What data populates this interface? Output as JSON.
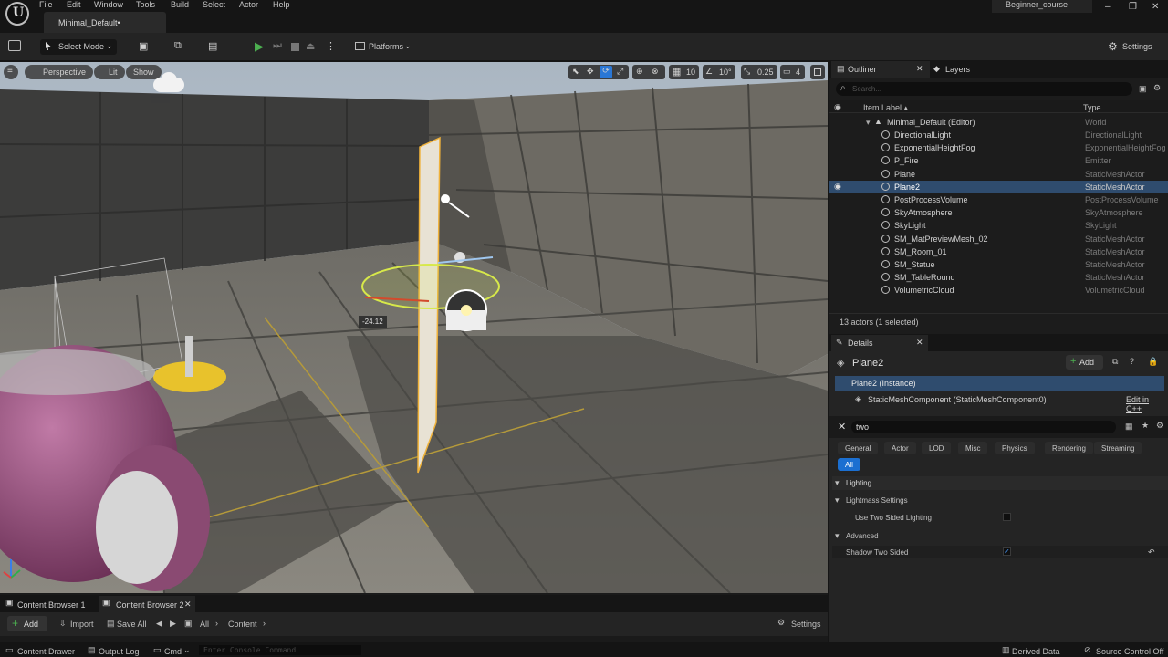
{
  "menubar": {
    "items": [
      "File",
      "Edit",
      "Window",
      "Tools",
      "Build",
      "Select",
      "Actor",
      "Help"
    ],
    "level_tab": "Minimal_Default•",
    "project": "Beginner_course",
    "window_controls": [
      "–",
      "❐",
      "✕"
    ]
  },
  "toolbar": {
    "select_mode": "Select Mode",
    "platforms": "Platforms",
    "settings": "Settings"
  },
  "viewport": {
    "perspective": "Perspective",
    "lit": "Lit",
    "show": "Show",
    "grid_snap": "10",
    "rot_snap": "10°",
    "scale_snap": "0.25",
    "cam_speed": "4",
    "gizmo_value": "-24.12"
  },
  "outliner": {
    "tab": "Outliner",
    "layers_tab": "Layers",
    "search_placeholder": "Search...",
    "col_label": "Item Label ▴",
    "col_type": "Type",
    "world_row": {
      "label": "Minimal_Default (Editor)",
      "type": "World"
    },
    "rows": [
      {
        "label": "DirectionalLight",
        "type": "DirectionalLight"
      },
      {
        "label": "ExponentialHeightFog",
        "type": "ExponentialHeightFog"
      },
      {
        "label": "P_Fire",
        "type": "Emitter"
      },
      {
        "label": "Plane",
        "type": "StaticMeshActor"
      },
      {
        "label": "Plane2",
        "type": "StaticMeshActor"
      },
      {
        "label": "PostProcessVolume",
        "type": "PostProcessVolume"
      },
      {
        "label": "SkyAtmosphere",
        "type": "SkyAtmosphere"
      },
      {
        "label": "SkyLight",
        "type": "SkyLight"
      },
      {
        "label": "SM_MatPreviewMesh_02",
        "type": "StaticMeshActor"
      },
      {
        "label": "SM_Room_01",
        "type": "StaticMeshActor"
      },
      {
        "label": "SM_Statue",
        "type": "StaticMeshActor"
      },
      {
        "label": "SM_TableRound",
        "type": "StaticMeshActor"
      },
      {
        "label": "VolumetricCloud",
        "type": "VolumetricCloud"
      }
    ],
    "status": "13 actors (1 selected)"
  },
  "details": {
    "tab": "Details",
    "actor_name": "Plane2",
    "add": "Add",
    "instance": "Plane2 (Instance)",
    "component": "StaticMeshComponent (StaticMeshComponent0)",
    "edit_cpp": "Edit in C++",
    "search_value": "two",
    "filters": [
      "General",
      "Actor",
      "LOD",
      "Misc",
      "Physics",
      "Rendering",
      "Streaming"
    ],
    "filter_all": "All",
    "section_lighting": "Lighting",
    "lightmass": "Lightmass Settings",
    "use_two_sided": "Use Two Sided Lighting",
    "use_two_sided_checked": false,
    "advanced": "Advanced",
    "shadow_two_sided": "Shadow Two Sided",
    "shadow_two_sided_checked": true
  },
  "content": {
    "tab1": "Content Browser 1",
    "tab2": "Content Browser 2",
    "add": "Add",
    "import": "Import",
    "save_all": "Save All",
    "path_all": "All",
    "path_content": "Content",
    "settings": "Settings"
  },
  "statusbar": {
    "content_drawer": "Content Drawer",
    "output_log": "Output Log",
    "cmd": "Cmd",
    "console_placeholder": "Enter Console Command",
    "derived_data": "Derived Data",
    "source_control": "Source Control Off"
  }
}
